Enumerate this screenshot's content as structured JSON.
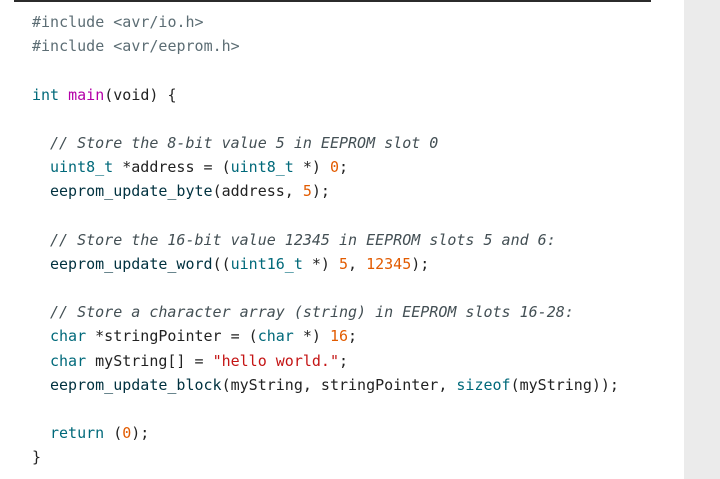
{
  "code": {
    "include_1": "#include <avr/io.h>",
    "include_2": "#include <avr/eeprom.h>",
    "main_type": "int",
    "main_name": "main",
    "main_params": "(void) {",
    "comment_1": "// Store the 8-bit value 5 in EEPROM slot 0",
    "l5_type": "uint8_t",
    "l5_mid": " *address = (",
    "l5_cast": "uint8_t",
    "l5_end_a": " *) ",
    "l5_num": "0",
    "l5_end_b": ";",
    "l6_fn": "eeprom_update_byte",
    "l6_a": "(address, ",
    "l6_num": "5",
    "l6_b": ");",
    "comment_2": "// Store the 16-bit value 12345 in EEPROM slots 5 and 6:",
    "l8_fn": "eeprom_update_word",
    "l8_a": "((",
    "l8_cast": "uint16_t",
    "l8_b": " *) ",
    "l8_num1": "5",
    "l8_c": ", ",
    "l8_num2": "12345",
    "l8_d": ");",
    "comment_3": "// Store a character array (string) in EEPROM slots 16-28:",
    "l10_type": "char",
    "l10_a": " *stringPointer = (",
    "l10_cast": "char",
    "l10_b": " *) ",
    "l10_num": "16",
    "l10_c": ";",
    "l11_type": "char",
    "l11_a": " myString[] = ",
    "l11_str": "\"hello world.\"",
    "l11_b": ";",
    "l12_fn": "eeprom_update_block",
    "l12_a": "(myString, stringPointer, ",
    "l12_kw": "sizeof",
    "l12_b": "(myString));",
    "l13_kw": "return",
    "l13_a": " (",
    "l13_num": "0",
    "l13_b": ");",
    "closing_brace": "}"
  }
}
